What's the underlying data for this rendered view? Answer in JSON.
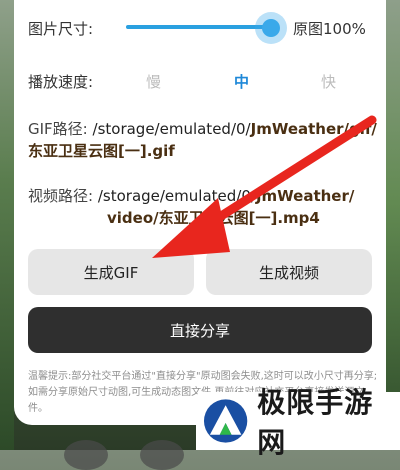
{
  "size_row": {
    "label": "图片尺寸:",
    "value": "原图100%",
    "fraction": 0.93
  },
  "speed_row": {
    "label": "播放速度:",
    "options": [
      {
        "label": "慢",
        "selected": false
      },
      {
        "label": "中",
        "selected": true
      },
      {
        "label": "快",
        "selected": false
      }
    ]
  },
  "gif_path": {
    "label": "GIF路径:",
    "prefix": "/storage/emulated/0/",
    "folder": "JmWeather/gif/",
    "filename": "东亚卫星云图[一].gif"
  },
  "video_path": {
    "label": "视频路径:",
    "prefix": "/storage/emulated/0/",
    "folder": "JmWeather/",
    "folder2": "video/",
    "filename": "东亚卫星云图[一].mp4"
  },
  "buttons": {
    "gen_gif": "生成GIF",
    "gen_video": "生成视频",
    "share": "直接分享"
  },
  "tip": "温馨提示:部分社交平台通过\"直接分享\"原动图会失败,这时可以改小尺寸再分享;如需分享原始尺寸动图,可生成动态图文件,再前往对应社交平台直接发送源文件。",
  "watermark": {
    "text": "极限手游网"
  },
  "colors": {
    "accent": "#2aa0e0",
    "arrow": "#e8261e",
    "share_button": "#2f2f2f"
  }
}
